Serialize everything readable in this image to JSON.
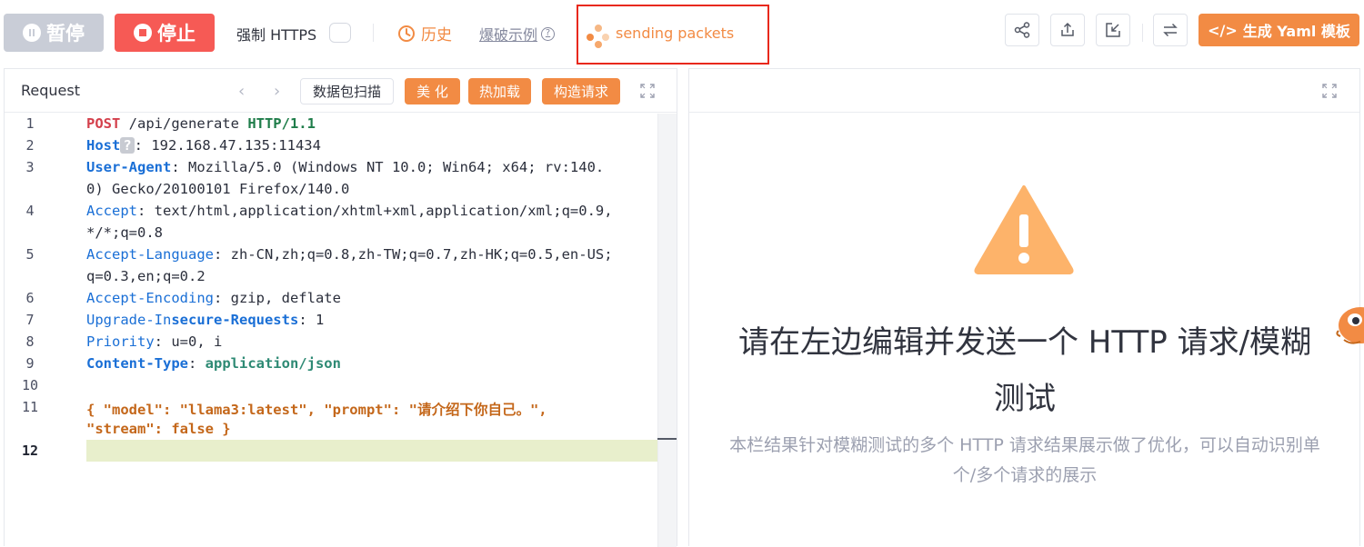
{
  "toolbar": {
    "pause_label": "暂停",
    "stop_label": "停止",
    "https_label": "强制 HTTPS",
    "history_label": "历史",
    "example_label": "爆破示例",
    "sending_status": "sending packets",
    "yaml_label": "生成 Yaml 模板"
  },
  "request": {
    "title": "Request",
    "scan_label": "数据包扫描",
    "beautify_label": "美 化",
    "hotload_label": "热加载",
    "construct_label": "构造请求",
    "line_numbers": [
      "1",
      "2",
      "3",
      "4",
      "5",
      "6",
      "7",
      "8",
      "9",
      "10",
      "11",
      "12"
    ],
    "lines": {
      "l1_method": "POST",
      "l1_path": " /api/generate ",
      "l1_proto": "HTTP/1.1",
      "l2_key": "Host",
      "l2_badge": "?",
      "l2_val": ": 192.168.47.135:11434",
      "l3_key": "User-Agent",
      "l3_val": ": Mozilla/5.0 (Windows NT 10.0; Win64; x64; rv:140.",
      "l3_val2": "0) Gecko/20100101 Firefox/140.0",
      "l4_key": "Accept",
      "l4_val": ": text/html,application/xhtml+xml,application/xml;q=0.9,",
      "l4_val2": "*/*;q=0.8",
      "l5_key": "Accept-Language",
      "l5_val": ": zh-CN,zh;q=0.8,zh-TW;q=0.7,zh-HK;q=0.5,en-US;",
      "l5_val2": "q=0.3,en;q=0.2",
      "l6_key": "Accept-Encoding",
      "l6_val": ": gzip, deflate",
      "l7_key_a": "Upgrade-In",
      "l7_key_b": "secure-Requests",
      "l7_val": ": 1",
      "l8_key": "Priority",
      "l8_val": ": u=0, i",
      "l9_key": "Content-Type",
      "l9_sep": ": ",
      "l9_val": "application/json",
      "l11_a": "{ \"model\": \"llama3:latest\", \"prompt\": \"请介绍下你自己。\",",
      "l11_b": "\"stream\": false }"
    }
  },
  "response": {
    "empty_title": "请在左边编辑并发送一个 HTTP 请求/模糊测试",
    "empty_desc": "本栏结果针对模糊测试的多个 HTTP 请求结果展示做了优化，可以自动识别单个/多个请求的展示"
  },
  "colors": {
    "accent": "#f28b44",
    "stop": "#f65a55",
    "pause": "#c9cdd7",
    "highlight_border": "#e8281c"
  }
}
